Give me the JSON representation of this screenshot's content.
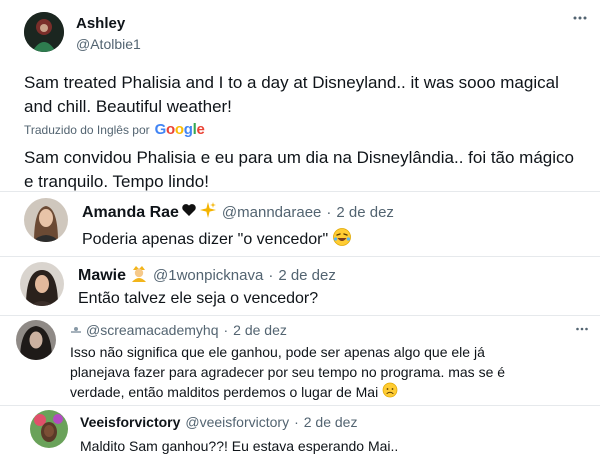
{
  "main_tweet": {
    "author_name": "Ashley",
    "author_handle": "@Atolbie1",
    "text": "Sam treated Phalisia and I to a day at Disneyland.. it was sooo magical and chill. Beautiful weather!",
    "translated_by": "Traduzido do Inglês por",
    "translator": "Google",
    "translation": "Sam convidou Phalisia e eu para um dia na Disneylândia.. foi tão mágico e tranquilo. Tempo lindo!",
    "more_icon": "more-horizontal-icon"
  },
  "replies": [
    {
      "name": "Amanda Rae",
      "name_emojis": [
        "black-heart-icon",
        "sparkles-icon"
      ],
      "handle": "@manndaraee",
      "separator": "·",
      "date": "2 de dez",
      "text": "Poderia apenas dizer \"o vencedor\"",
      "text_emoji": "rofl-emoji-icon"
    },
    {
      "name": "Mawie",
      "name_emojis": [
        "person-emoji-icon"
      ],
      "handle": "@1wonpicknava",
      "separator": "·",
      "date": "2 de dez",
      "text": "Então talvez ele seja o vencedor?"
    },
    {
      "name": "",
      "handle": "@screamacademyhq",
      "separator": "·",
      "date": "2 de dez",
      "text_line1": "Isso não significa que ele ganhou, pode ser apenas algo que ele já",
      "text_line2": "planejava fazer para agradecer por seu tempo no programa. mas se é",
      "text_line3": "verdade, então malditos perdemos o lugar de Mai",
      "text_emoji": "disappointed-emoji-icon",
      "more_icon": "more-horizontal-icon"
    },
    {
      "name": "Veeisforvictory",
      "handle": "@veeisforvictory",
      "separator": "·",
      "date": "2 de dez",
      "text": "Maldito Sam ganhou??! Eu estava esperando Mai.."
    }
  ],
  "colors": {
    "text": "#0f1419",
    "muted": "#536471",
    "link": "#1d9bf0",
    "google_blue": "#4285f4",
    "google_red": "#ea4335",
    "google_yellow": "#fbbc05",
    "google_green": "#34a853"
  }
}
